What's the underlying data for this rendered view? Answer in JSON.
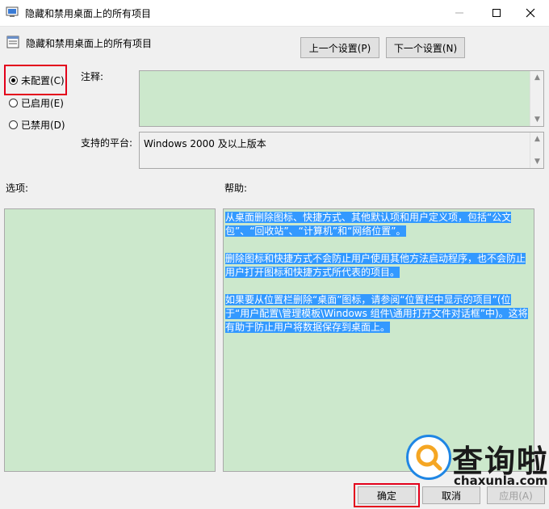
{
  "window": {
    "title": "隐藏和禁用桌面上的所有项目"
  },
  "header": {
    "title": "隐藏和禁用桌面上的所有项目",
    "prev_label": "上一个设置(P)",
    "next_label": "下一个设置(N)"
  },
  "radios": [
    {
      "label": "未配置(C)",
      "selected": true
    },
    {
      "label": "已启用(E)",
      "selected": false
    },
    {
      "label": "已禁用(D)",
      "selected": false
    }
  ],
  "labels": {
    "comment": "注释:",
    "platform": "支持的平台:",
    "options": "选项:",
    "help": "帮助:"
  },
  "platform_value": "Windows 2000 及以上版本",
  "help_text": [
    "从桌面删除图标、快捷方式、其他默认项和用户定义项，包括“公文包”、“回收站”、“计算机”和“网络位置”。",
    "删除图标和快捷方式不会防止用户使用其他方法启动程序，也不会防止用户打开图标和快捷方式所代表的项目。",
    "如果要从位置栏删除“桌面”图标，请参阅“位置栏中显示的项目”(位于“用户配置\\管理模板\\Windows 组件\\通用打开文件对话框”中)。这将有助于防止用户将数据保存到桌面上。"
  ],
  "buttons": {
    "ok": "确定",
    "cancel": "取消",
    "apply": "应用(A)"
  },
  "watermark": {
    "logo": "查询啦",
    "site": "chaxunla.com"
  },
  "colors": {
    "pane_green": "#cce8cc",
    "selection_blue": "#3399ff",
    "highlight_red": "#e3001b"
  }
}
